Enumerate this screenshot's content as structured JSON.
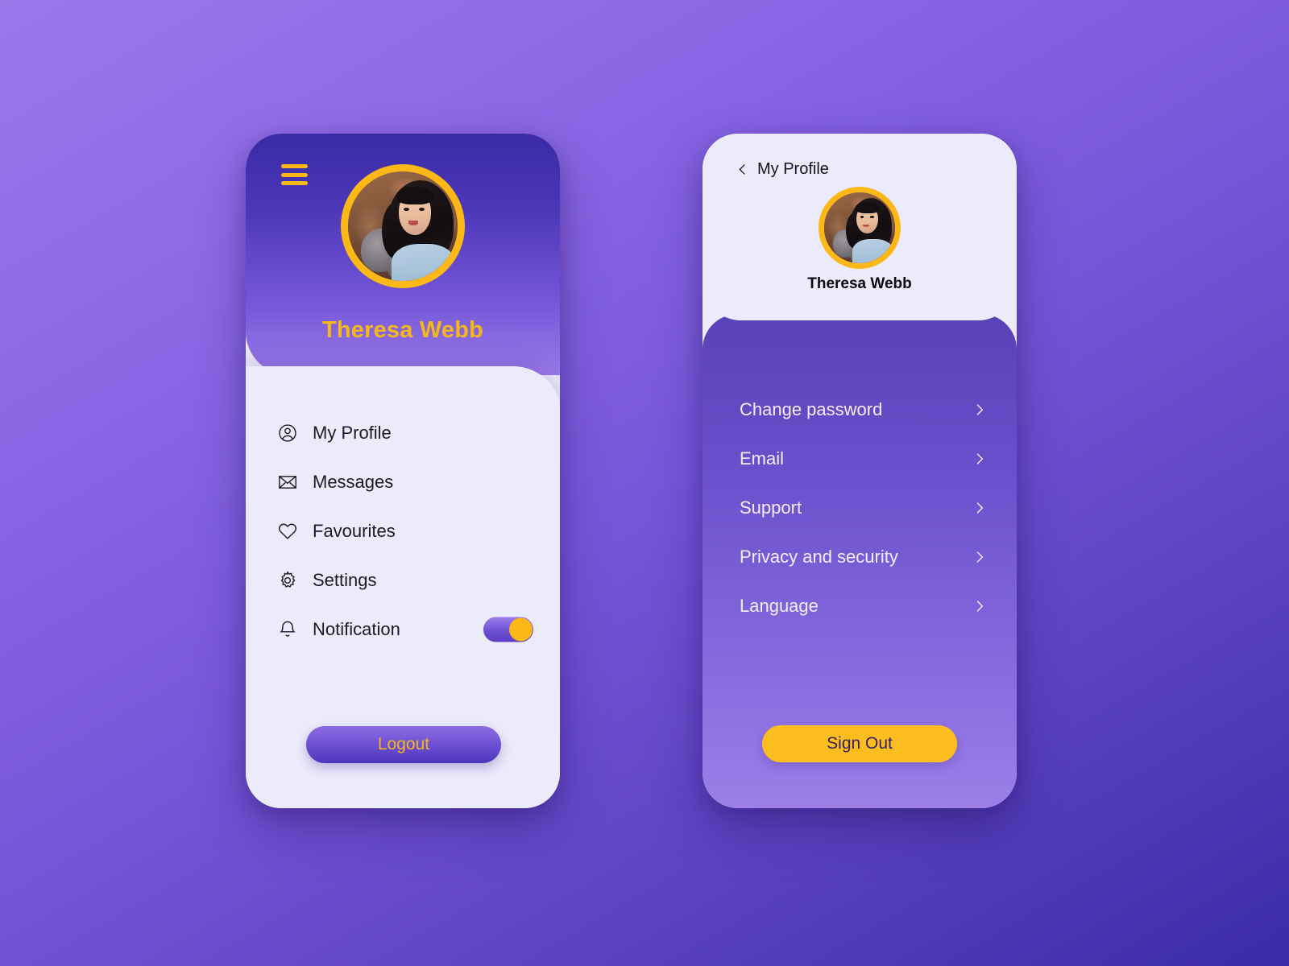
{
  "theme": {
    "accent_amber": "#fcb817",
    "purple_dark": "#3a2ba5",
    "purple_light": "#9b7be8",
    "card_bg": "#ecebfb",
    "text_dark": "#1c1b20"
  },
  "left_screen": {
    "menu_icon": "hamburger-icon",
    "avatar_alt": "profile-photo",
    "user_name": "Theresa Webb",
    "menu_items": [
      {
        "label": "My Profile",
        "icon": "user-circle-icon",
        "has_toggle": false
      },
      {
        "label": "Messages",
        "icon": "envelope-icon",
        "has_toggle": false
      },
      {
        "label": "Favourites",
        "icon": "heart-icon",
        "has_toggle": false
      },
      {
        "label": "Settings",
        "icon": "gear-icon",
        "has_toggle": false
      },
      {
        "label": "Notification",
        "icon": "bell-icon",
        "has_toggle": true,
        "toggle_state": "on"
      }
    ],
    "logout_label": "Logout"
  },
  "right_screen": {
    "back_icon": "chevron-left-icon",
    "back_label": "My Profile",
    "avatar_alt": "profile-photo",
    "user_name": "Theresa Webb",
    "settings_items": [
      {
        "label": "Change password",
        "chevron": "chevron-right-icon"
      },
      {
        "label": "Email",
        "chevron": "chevron-right-icon"
      },
      {
        "label": "Support",
        "chevron": "chevron-right-icon"
      },
      {
        "label": "Privacy and security",
        "chevron": "chevron-right-icon"
      },
      {
        "label": "Language",
        "chevron": "chevron-right-icon"
      }
    ],
    "signout_label": "Sign Out"
  }
}
